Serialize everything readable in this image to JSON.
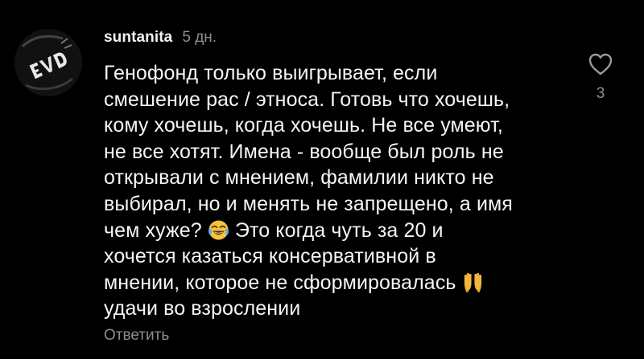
{
  "comment": {
    "username": "suntanita",
    "time": "5 дн.",
    "text_lines": [
      "Генофонд только выигрывает, если",
      "смешение рас / этноса. Готовь что хочешь,",
      "кому хочешь, когда хочешь. Не все умеют,",
      "не все хотят. Имена - вообще был роль не",
      "открывали с мнением, фамилии никто не",
      "выбирал, но и менять не запрещено, а имя",
      "чем хуже?",
      "Это когда чуть за 20 и",
      "хочется казаться консервативной в",
      "мнении, которое не сформировалась",
      "удачи во взрослении"
    ],
    "emojis": [
      "face-with-tears-of-joy",
      "raising-hands"
    ],
    "reply_label": "Ответить",
    "like_count": "3",
    "icons": {
      "like": "heart-outline-icon",
      "avatar": "avatar-logo"
    }
  },
  "colors": {
    "background": "#000000",
    "text_primary": "#f5f5f5",
    "text_secondary": "#8e8e8e",
    "emoji_yellow": "#f7c23c"
  }
}
